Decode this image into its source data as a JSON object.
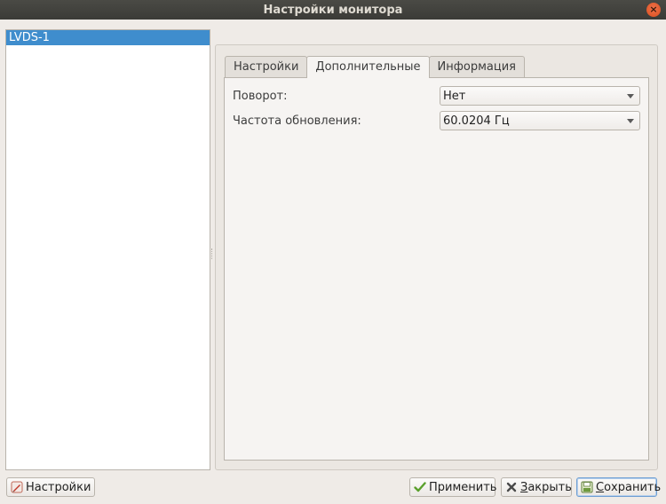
{
  "window": {
    "title": "Настройки монитора",
    "close_glyph": "×"
  },
  "monitors": [
    {
      "label": "LVDS-1",
      "selected": true
    }
  ],
  "tabs": [
    {
      "label": "Настройки",
      "active": false
    },
    {
      "label": "Дополнительные",
      "active": true
    },
    {
      "label": "Информация",
      "active": false
    }
  ],
  "advanced": {
    "rotation_label": "Поворот:",
    "rotation_value": "Нет",
    "refresh_label": "Частота обновления:",
    "refresh_value": "60.0204 Гц"
  },
  "buttons": {
    "settings": {
      "label": "Настройки",
      "icon": "settings-pencil-icon"
    },
    "apply": {
      "label": "Применить",
      "icon": "checkmark-icon"
    },
    "close": {
      "label_first": "З",
      "label_rest": "акрыть",
      "icon": "x-icon"
    },
    "save": {
      "label_first": "С",
      "label_rest": "охранить",
      "icon": "save-icon"
    }
  },
  "colors": {
    "selection": "#3f8dcd",
    "close_button": "#e0582a",
    "titlebar": "#3b3b37"
  }
}
